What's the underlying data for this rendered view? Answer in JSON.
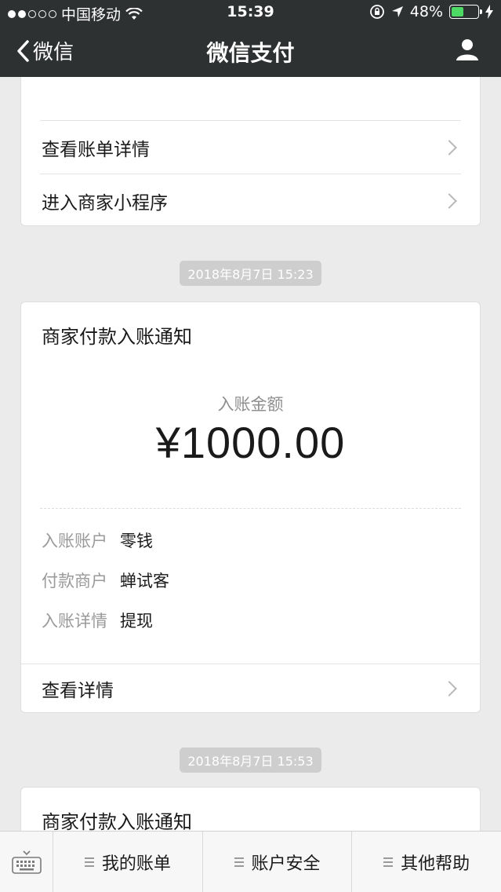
{
  "status_bar": {
    "carrier": "中国移动",
    "time": "15:39",
    "battery_percent": "48%",
    "battery_level": 0.48,
    "signal_dots_filled": 2,
    "signal_dots_total": 5
  },
  "nav": {
    "back_label": "微信",
    "title": "微信支付"
  },
  "card1": {
    "links": [
      {
        "label": "查看账单详情"
      },
      {
        "label": "进入商家小程序"
      }
    ]
  },
  "messages": [
    {
      "timestamp": "2018年8月7日 15:23",
      "title": "商家付款入账通知",
      "amount_label": "入账金额",
      "amount": "¥1000.00",
      "details": [
        {
          "key": "入账账户",
          "value": "零钱"
        },
        {
          "key": "付款商户",
          "value": "蝉试客"
        },
        {
          "key": "入账详情",
          "value": "提现"
        }
      ],
      "detail_link": "查看详情"
    },
    {
      "timestamp": "2018年8月7日 15:53",
      "title": "商家付款入账通知"
    }
  ],
  "bottom_menu": {
    "items": [
      {
        "label": "我的账单"
      },
      {
        "label": "账户安全"
      },
      {
        "label": "其他帮助"
      }
    ]
  },
  "colors": {
    "header_bg": "#2e3132",
    "page_bg": "#ebebeb",
    "battery_fill": "#4cd964"
  }
}
